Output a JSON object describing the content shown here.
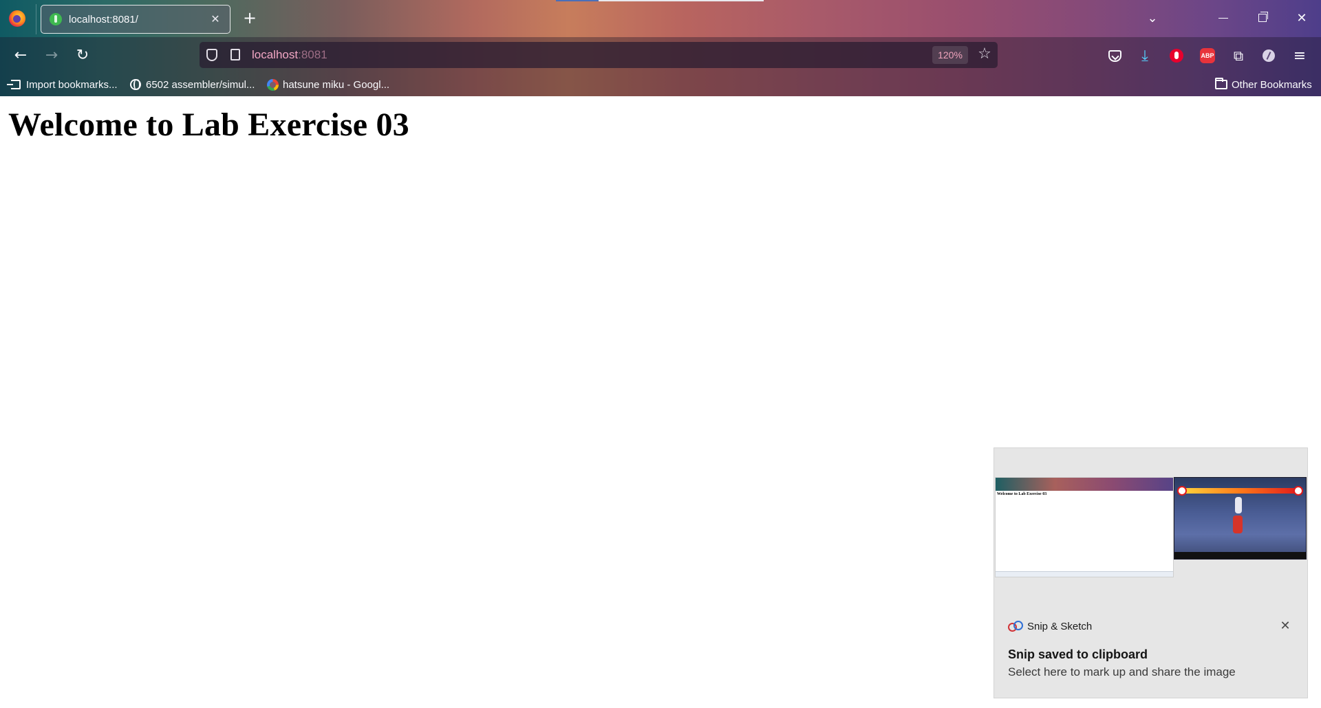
{
  "browser": {
    "tab": {
      "title": "localhost:8081/",
      "close_glyph": "✕"
    },
    "new_tab_glyph": "+",
    "tab_list_glyph": "⌄",
    "window_controls": {
      "close_glyph": "✕"
    },
    "nav": {
      "back_glyph": "←",
      "forward_glyph": "→",
      "reload_glyph": "↻"
    },
    "url": {
      "host": "localhost",
      "port": ":8081"
    },
    "zoom": "120%",
    "bookmark_star_glyph": "☆",
    "toolbar_icons": [
      "pocket-icon",
      "download-icon",
      "ublock-hand-icon",
      "adblock-plus-icon",
      "extensions-icon",
      "feather-icon",
      "menu-icon"
    ],
    "download_glyph": "⤓",
    "extensions_glyph": "⧉",
    "menu_glyph": "≡",
    "bookmarks": [
      {
        "label": "Import bookmarks...",
        "icon": "import-icon"
      },
      {
        "label": "6502 assembler/simul...",
        "icon": "globe-icon"
      },
      {
        "label": "hatsune miku - Googl...",
        "icon": "google-icon"
      }
    ],
    "other_bookmarks": "Other Bookmarks",
    "accent_colors": {
      "url_text": "#f3a7c5",
      "download": "#54d1ff",
      "tab_favicon": "#3fb950"
    }
  },
  "page": {
    "heading": "Welcome to Lab Exercise 03"
  },
  "toast": {
    "app_name": "Snip & Sketch",
    "heading": "Snip saved to clipboard",
    "body": "Select here to mark up and share the image",
    "preview_mini_title": "Welcome to Lab Exercise 03",
    "close_glyph": "✕"
  }
}
